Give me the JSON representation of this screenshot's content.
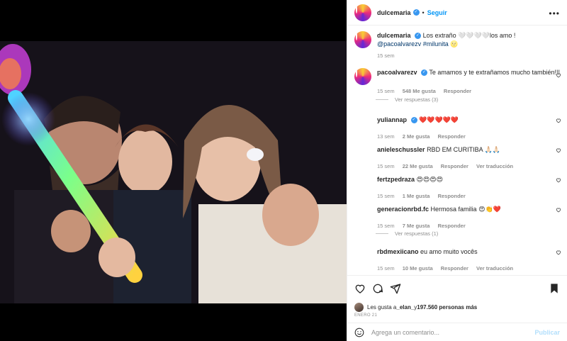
{
  "post": {
    "author": "dulcemaria",
    "follow_label": "Seguir",
    "separator": "•",
    "more_label": "•••"
  },
  "caption": {
    "username": "dulcemaria",
    "text": "Los extraño ",
    "emoji_text": "🤍🤍🤍🤍",
    "text2": "los amo ! ",
    "mention": "@pacoalvarezv",
    "hashtag": "#milunita",
    "hashtag_emoji": "🌝",
    "time": "15 sem"
  },
  "comments": [
    {
      "username": "pacoalvarezv",
      "verified": true,
      "text": "Te amamos y te extrañamos mucho también!!!",
      "time": "15 sem",
      "likes": "548 Me gusta",
      "reply": "Responder",
      "view_replies": "Ver respuestas (3)"
    },
    {
      "username": "yuliannap",
      "verified": true,
      "text": "❤️❤️❤️❤️❤️",
      "time": "13 sem",
      "likes": "2 Me gusta",
      "reply": "Responder"
    },
    {
      "username": "anieleschussler",
      "text": "RBD EM CURITIBA 🙏🏻🙏🏻",
      "time": "15 sem",
      "likes": "22 Me gusta",
      "reply": "Responder",
      "translate": "Ver traducción"
    },
    {
      "username": "fertzpedraza",
      "text": "😍😍😍😍",
      "time": "15 sem",
      "likes": "1 Me gusta",
      "reply": "Responder"
    },
    {
      "username": "generacionrbd.fc",
      "text": "Hermosa familia",
      "text_emoji": "😍👏❤️",
      "time": "15 sem",
      "likes": "7 Me gusta",
      "reply": "Responder",
      "view_replies": "Ver respuestas (1)"
    },
    {
      "username": "rbdmexiicano",
      "text": "eu amo muito vocês",
      "time": "15 sem",
      "likes": "10 Me gusta",
      "reply": "Responder",
      "translate": "Ver traducción"
    }
  ],
  "likes": {
    "prefix": "Les gusta a ",
    "user": "_elan_",
    "middle": " y ",
    "count": "197.560 personas más"
  },
  "date": "ENERO 21",
  "composer": {
    "placeholder": "Agrega un comentario...",
    "publish_label": "Publicar"
  },
  "colors": {
    "accent": "#0095f6",
    "like_red": "#ed4956",
    "muted": "#8e8e8e"
  },
  "icons": [
    "heart-icon",
    "comment-icon",
    "share-icon",
    "bookmark-icon",
    "emoji-icon",
    "more-icon",
    "verified-icon"
  ]
}
